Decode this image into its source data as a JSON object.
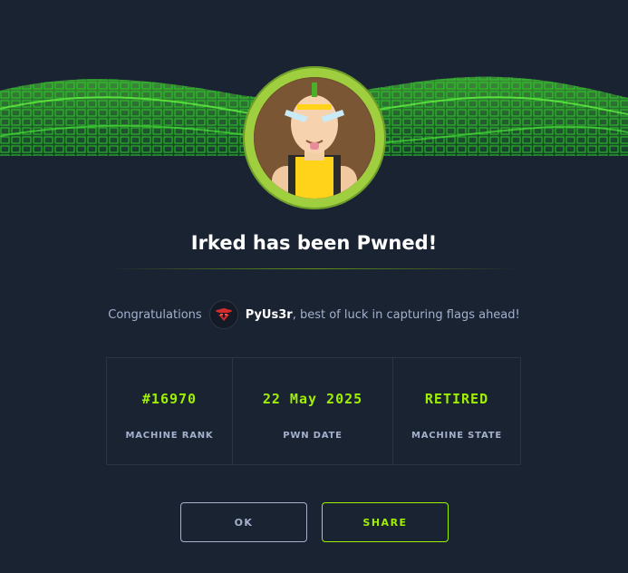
{
  "colors": {
    "background": "#1a2332",
    "accent": "#9fef00",
    "muted_text": "#a4b1cd",
    "panel_border": "#2a3447"
  },
  "dialog": {
    "title": "Irked has been Pwned!",
    "congrats_prefix": "Congratulations",
    "username": "PyUs3r",
    "congrats_suffix": ", best of luck in capturing flags ahead!"
  },
  "stats": [
    {
      "value": "#16970",
      "label": "MACHINE RANK"
    },
    {
      "value": "22 May 2025",
      "label": "PWN DATE"
    },
    {
      "value": "RETIRED",
      "label": "MACHINE STATE"
    }
  ],
  "buttons": {
    "ok": "OK",
    "share": "SHARE"
  },
  "icons": {
    "machine_avatar": "machine-avatar-icon",
    "user_avatar": "hacker-avatar-icon"
  }
}
